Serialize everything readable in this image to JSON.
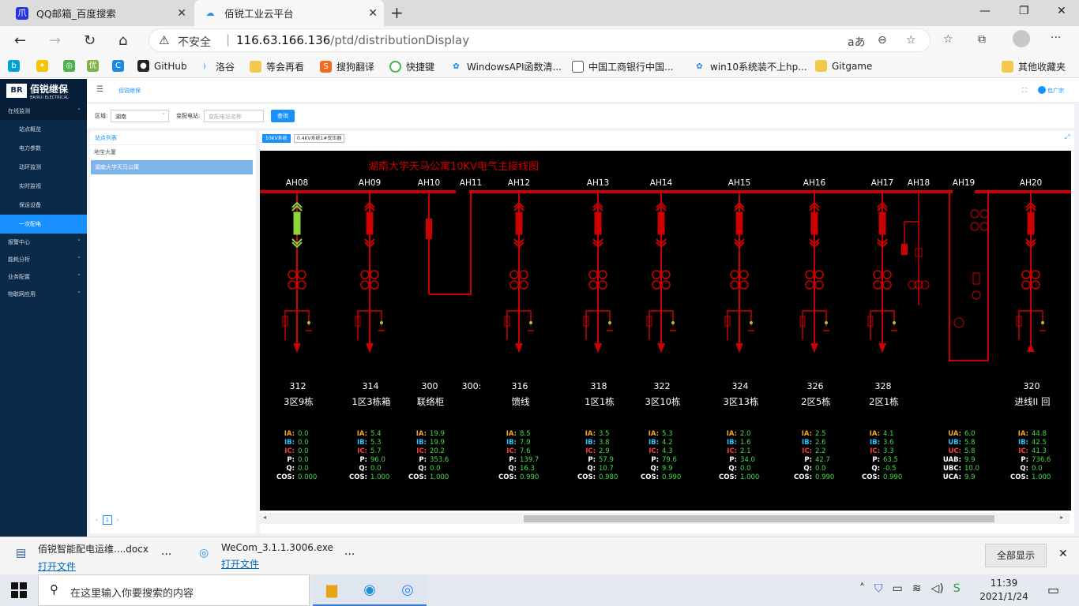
{
  "browser": {
    "tabs": [
      {
        "title": "QQ邮箱_百度搜索",
        "icon": "baidu-paw-icon"
      },
      {
        "title": "佰锐工业云平台",
        "icon": "cloud-icon"
      }
    ],
    "security_label": "不安全",
    "url_host": "116.63.166.136",
    "url_path": "/ptd/distributionDisplay",
    "bookmarks": [
      "GitHub",
      "洛谷",
      "等会再看",
      "搜狗翻译",
      "快捷键",
      "WindowsAPI函数清...",
      "中国工商银行中国...",
      "win10系统装不上hp...",
      "Gitgame"
    ],
    "other_bookmarks": "其他收藏夹"
  },
  "app": {
    "logo": {
      "name": "佰锐继保",
      "sub": "BAIRUI ELECTRICAL"
    },
    "sidebar": {
      "group_online": "在线监测",
      "items": [
        "站点概览",
        "电力参数",
        "动环监测",
        "实时监视",
        "保运设备",
        "一次配电"
      ],
      "groups": [
        "报警中心",
        "能耗分析",
        "业务配置",
        "物联网应用"
      ]
    },
    "topnav": {
      "breadcrumb": "佰锐继保",
      "user": "包广宗"
    },
    "filter": {
      "region_label": "区域:",
      "region_value": "湖南",
      "station_label": "变配电站:",
      "station_placeholder": "变配电站名称",
      "query": "查询"
    },
    "station_list": {
      "header": "站点列表",
      "items": [
        "地宝大厦",
        "湖南大学天马公寓"
      ],
      "page": "1"
    },
    "diagram_tabs": [
      "10KV系统",
      "0.4KV系统1#变压器"
    ],
    "diagram": {
      "title": "湖南大学天马公寓10KV电气主接线图",
      "cabinets": [
        {
          "id": "AH08",
          "num": "312",
          "name": "3区9栋",
          "type": "feeder",
          "green": true,
          "m": [
            [
              "IA:",
              "0.0"
            ],
            [
              "IB:",
              "0.0"
            ],
            [
              "IC:",
              "0.0"
            ],
            [
              "P:",
              "0.0"
            ],
            [
              "Q:",
              "0.0"
            ],
            [
              "COS:",
              "0.000"
            ]
          ]
        },
        {
          "id": "AH09",
          "num": "314",
          "name": "1区3栋箱",
          "type": "feeder",
          "green": false,
          "m": [
            [
              "IA:",
              "5.4"
            ],
            [
              "IB:",
              "5.3"
            ],
            [
              "IC:",
              "5.7"
            ],
            [
              "P:",
              "96.0"
            ],
            [
              "Q:",
              "0.0"
            ],
            [
              "COS:",
              "1.000"
            ]
          ]
        },
        {
          "id": "AH10",
          "num": "300",
          "name": "联络柜",
          "type": "tie",
          "green": false,
          "m": [
            [
              "IA:",
              "19.9"
            ],
            [
              "IB:",
              "19.9"
            ],
            [
              "IC:",
              "20.2"
            ],
            [
              "P:",
              "353.6"
            ],
            [
              "Q:",
              "0.0"
            ],
            [
              "COS:",
              "1.000"
            ]
          ]
        },
        {
          "id": "AH11",
          "num": "300:",
          "name": "",
          "type": "riser",
          "green": false,
          "m": []
        },
        {
          "id": "AH12",
          "num": "316",
          "name": "馈线",
          "type": "feeder",
          "green": false,
          "m": [
            [
              "IA:",
              "8.5"
            ],
            [
              "IB:",
              "7.9"
            ],
            [
              "IC:",
              "7.6"
            ],
            [
              "P:",
              "139.7"
            ],
            [
              "Q:",
              "16.3"
            ],
            [
              "COS:",
              "0.990"
            ]
          ]
        },
        {
          "id": "AH13",
          "num": "318",
          "name": "1区1栋",
          "type": "feeder",
          "green": false,
          "m": [
            [
              "IA:",
              "3.5"
            ],
            [
              "IB:",
              "3.8"
            ],
            [
              "IC:",
              "2.9"
            ],
            [
              "P:",
              "57.9"
            ],
            [
              "Q:",
              "10.7"
            ],
            [
              "COS:",
              "0.980"
            ]
          ]
        },
        {
          "id": "AH14",
          "num": "322",
          "name": "3区10栋",
          "type": "feeder",
          "green": false,
          "m": [
            [
              "IA:",
              "5.3"
            ],
            [
              "IB:",
              "4.2"
            ],
            [
              "IC:",
              "4.3"
            ],
            [
              "P:",
              "79.6"
            ],
            [
              "Q:",
              "9.9"
            ],
            [
              "COS:",
              "0.990"
            ]
          ]
        },
        {
          "id": "AH15",
          "num": "324",
          "name": "3区13栋",
          "type": "feeder",
          "green": false,
          "m": [
            [
              "IA:",
              "2.0"
            ],
            [
              "IB:",
              "1.6"
            ],
            [
              "IC:",
              "2.1"
            ],
            [
              "P:",
              "34.0"
            ],
            [
              "Q:",
              "0.0"
            ],
            [
              "COS:",
              "1.000"
            ]
          ]
        },
        {
          "id": "AH16",
          "num": "326",
          "name": "2区5栋",
          "type": "feeder",
          "green": false,
          "m": [
            [
              "IA:",
              "2.5"
            ],
            [
              "IB:",
              "2.6"
            ],
            [
              "IC:",
              "2.2"
            ],
            [
              "P:",
              "42.7"
            ],
            [
              "Q:",
              "0.0"
            ],
            [
              "COS:",
              "0.990"
            ]
          ]
        },
        {
          "id": "AH17",
          "num": "328",
          "name": "2区1栋",
          "type": "feeder",
          "green": false,
          "m": [
            [
              "IA:",
              "4.1"
            ],
            [
              "IB:",
              "3.6"
            ],
            [
              "IC:",
              "3.3"
            ],
            [
              "P:",
              "63.5"
            ],
            [
              "Q:",
              "-0.5"
            ],
            [
              "COS:",
              "0.990"
            ]
          ]
        },
        {
          "id": "AH18",
          "num": "",
          "name": "",
          "type": "pt",
          "green": false,
          "m": []
        },
        {
          "id": "AH19",
          "num": "",
          "name": "",
          "type": "metering",
          "green": false,
          "m": [
            [
              "UA:",
              "6.0"
            ],
            [
              "UB:",
              "5.8"
            ],
            [
              "UC:",
              "5.8"
            ],
            [
              "UAB:",
              "9.9"
            ],
            [
              "UBC:",
              "10.0"
            ],
            [
              "UCA:",
              "9.9"
            ]
          ]
        },
        {
          "id": "AH20",
          "num": "320",
          "name": "进线II 回",
          "type": "incoming",
          "green": false,
          "m": [
            [
              "IA:",
              "44.8"
            ],
            [
              "IB:",
              "42.5"
            ],
            [
              "IC:",
              "41.3"
            ],
            [
              "P:",
              "736.6"
            ],
            [
              "Q:",
              "0.0"
            ],
            [
              "COS:",
              "1.000"
            ]
          ]
        }
      ]
    }
  },
  "downloads": [
    {
      "name": "佰锐智能配电运维....docx",
      "open": "打开文件"
    },
    {
      "name": "WeCom_3.1.1.3006.exe",
      "open": "打开文件"
    }
  ],
  "downloads_show_all": "全部显示",
  "taskbar": {
    "search_placeholder": "在这里输入你要搜索的内容",
    "time": "11:39",
    "date": "2021/1/24"
  },
  "colors": {
    "bus": "#cc0000",
    "sidebar": "#0b2a4a",
    "accent": "#1890ff",
    "energized": "#8ed43a"
  }
}
